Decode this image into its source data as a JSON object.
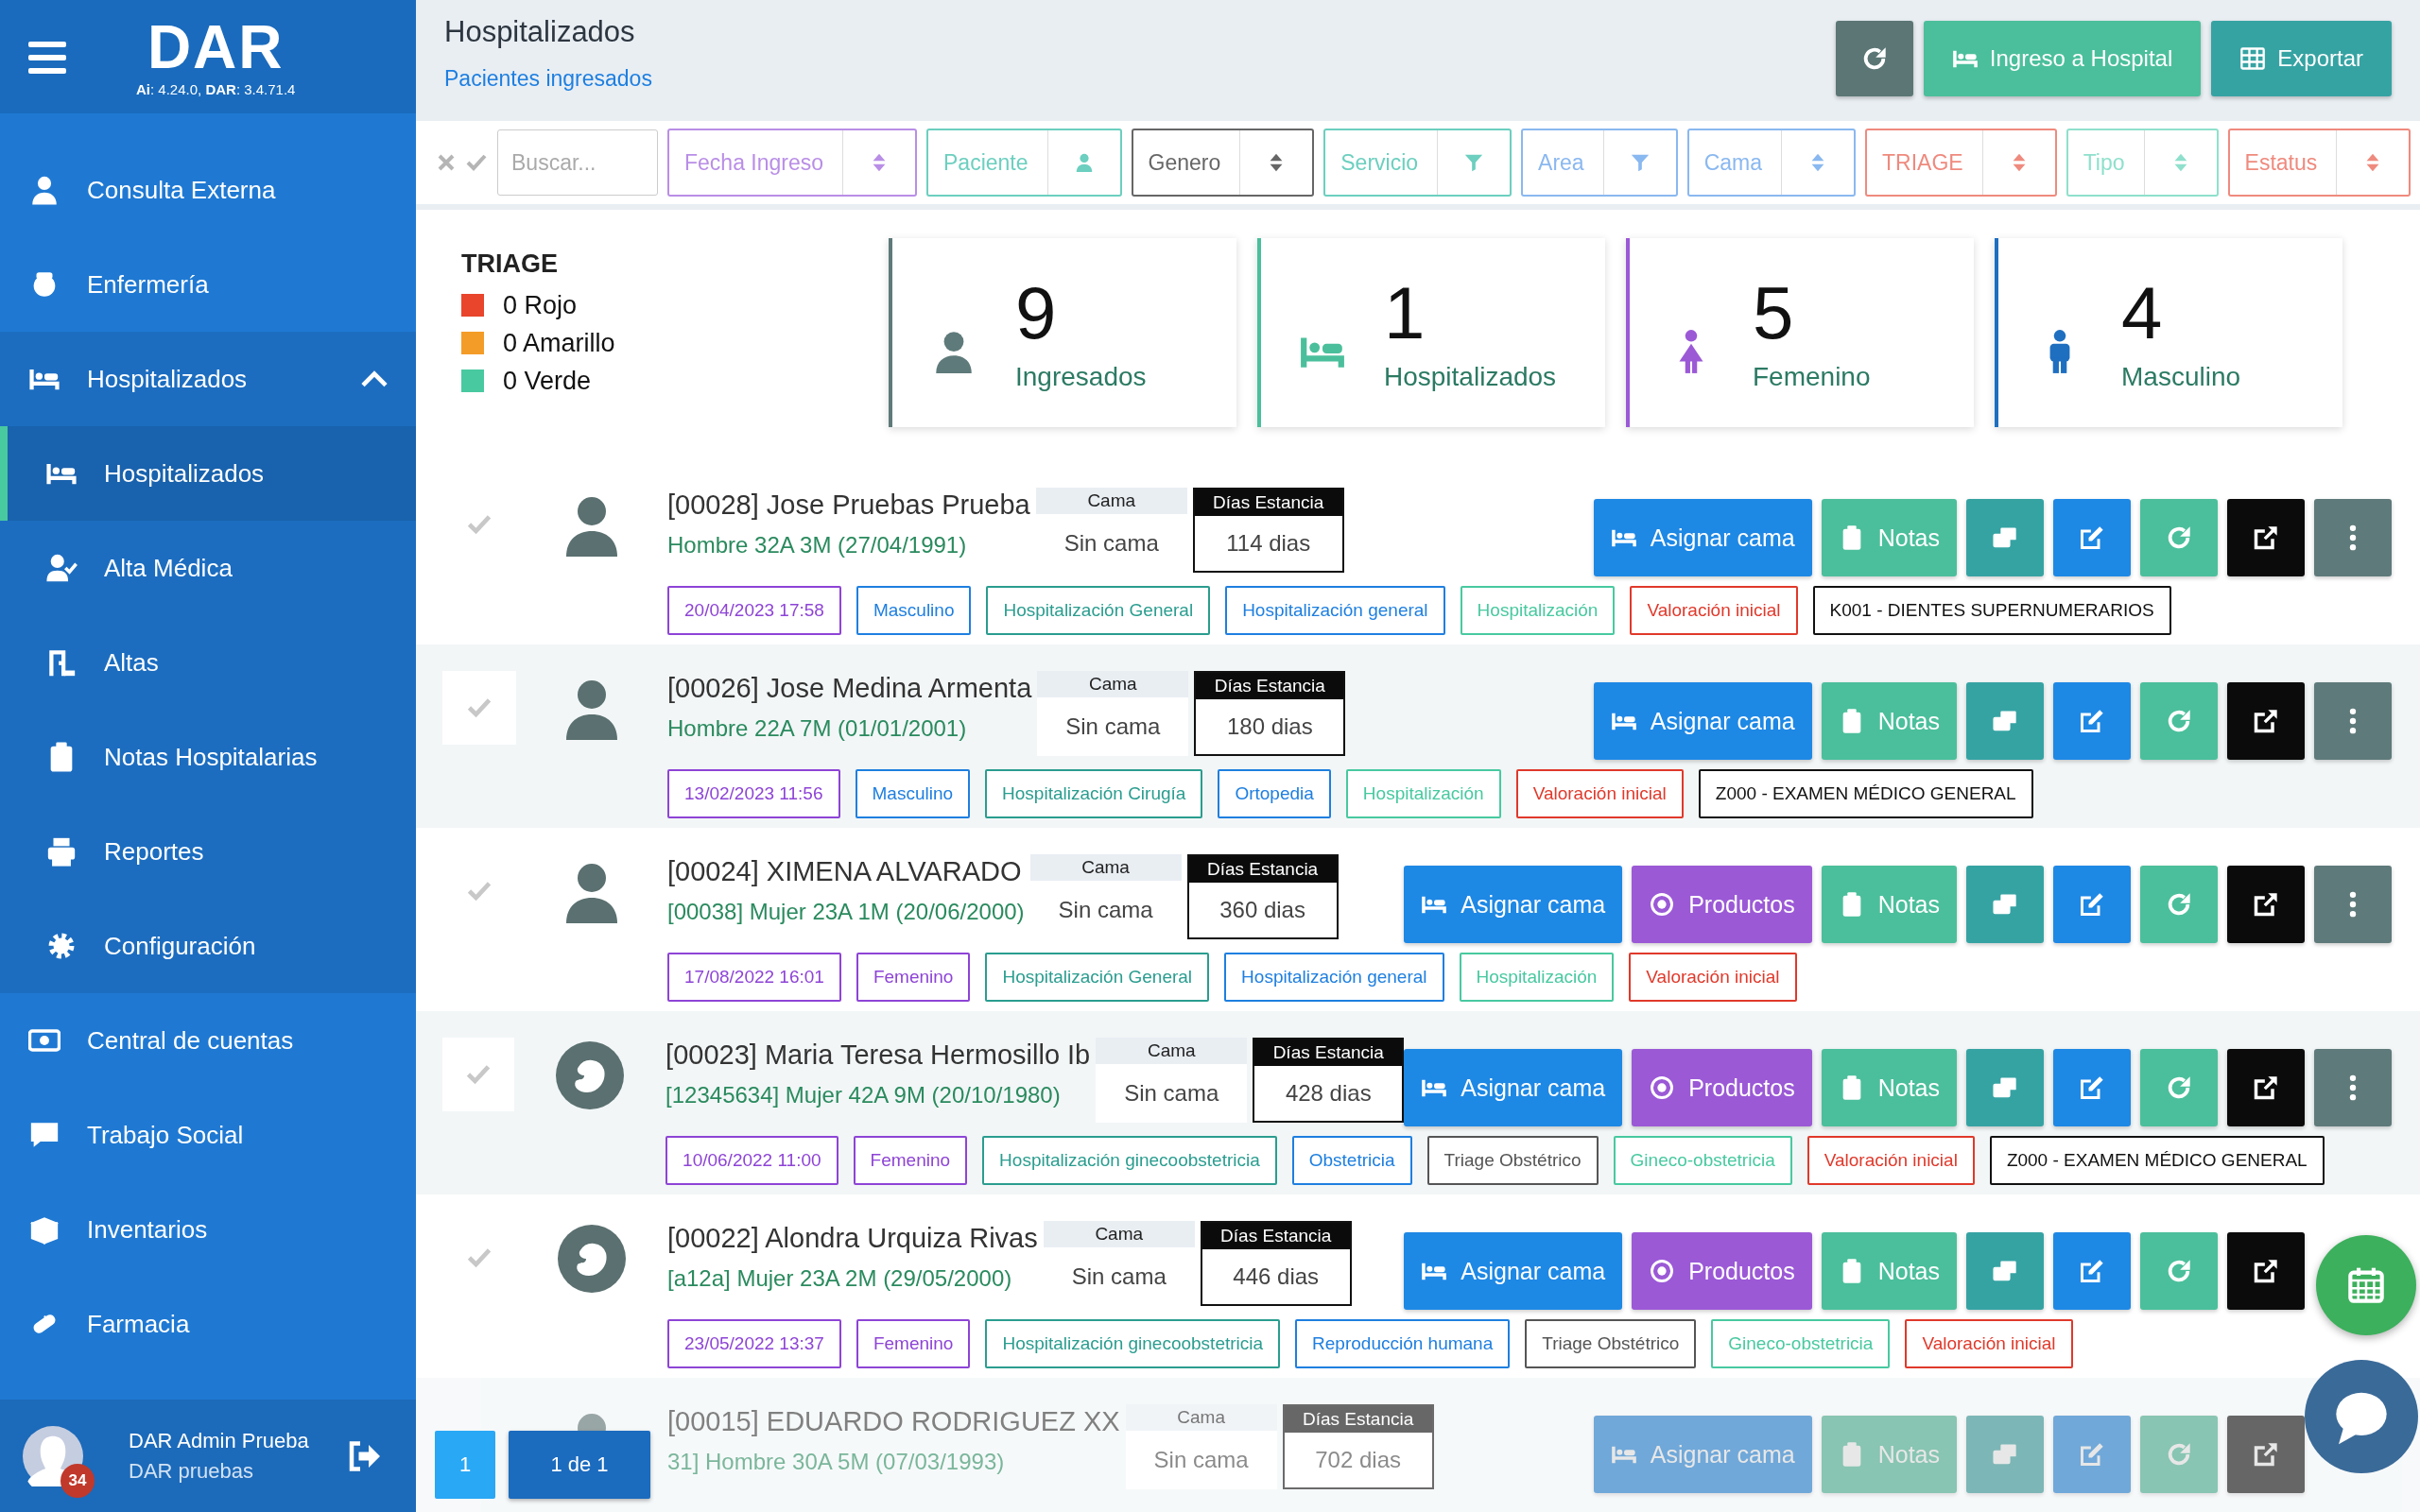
{
  "sidebar": {
    "logo": "DAR",
    "version": "**Ai**: 4.24.0, **DAR**: 3.4.71.4",
    "items": [
      {
        "label": "Consulta Externa"
      },
      {
        "label": "Enfermería"
      },
      {
        "label": "Hospitalizados",
        "expanded": true,
        "children": [
          {
            "label": "Hospitalizados",
            "selected": true
          },
          {
            "label": "Alta Médica",
            "selected": false
          },
          {
            "label": "Altas",
            "selected": false
          },
          {
            "label": "Notas Hospitalarias",
            "selected": false
          },
          {
            "label": "Reportes",
            "selected": false
          },
          {
            "label": "Configuración",
            "selected": false
          }
        ]
      },
      {
        "label": "Central de cuentas"
      },
      {
        "label": "Trabajo Social"
      },
      {
        "label": "Inventarios"
      },
      {
        "label": "Farmacia"
      }
    ],
    "user": {
      "name": "DAR Admin Prueba",
      "org": "DAR pruebas",
      "badge": "34"
    }
  },
  "header": {
    "title": "Hospitalizados",
    "subtitle": "Pacientes ingresados",
    "buttons": [
      {
        "kind": "refresh"
      },
      {
        "kind": "ingreso",
        "label": "Ingreso a Hospital"
      },
      {
        "kind": "export",
        "label": "Exportar"
      }
    ]
  },
  "filters": {
    "search": {
      "placeholder": "Buscar..."
    },
    "fields": [
      {
        "label": "Fecha Ingreso",
        "kind": "sort",
        "color": "#b98ee6"
      },
      {
        "label": "Paciente",
        "kind": "person",
        "color": "#6ccfbf"
      },
      {
        "label": "Genero",
        "kind": "sort",
        "color": "#666666"
      },
      {
        "label": "Servicio",
        "kind": "filter",
        "color": "#6ccfbf"
      },
      {
        "label": "Area",
        "kind": "filter",
        "color": "#8ab8f0"
      },
      {
        "label": "Cama",
        "kind": "sort",
        "color": "#8ab8f0"
      },
      {
        "label": "TRIAGE",
        "kind": "sort",
        "color": "#ef8a7e"
      },
      {
        "label": "Tipo",
        "kind": "sort",
        "color": "#8fe0cc"
      },
      {
        "label": "Estatus",
        "kind": "sort",
        "color": "#ef8a7e"
      }
    ]
  },
  "triage": {
    "title": "TRIAGE",
    "items": [
      {
        "label": "0 Rojo",
        "color": "#e8452c"
      },
      {
        "label": "0 Amarillo",
        "color": "#f39c28"
      },
      {
        "label": "0 Verde",
        "color": "#48c9a0"
      }
    ]
  },
  "stats": [
    {
      "value": "9",
      "label": "Ingresados",
      "color": "#5f7a7a"
    },
    {
      "value": "1",
      "label": "Hospitalizados",
      "color": "#4bbf9b"
    },
    {
      "value": "5",
      "label": "Femenino",
      "color": "#9b59d6"
    },
    {
      "value": "4",
      "label": "Masculino",
      "color": "#1e6fc0"
    }
  ],
  "patients": [
    {
      "kind": "general",
      "checked": false,
      "disabled": false,
      "name": "[00028] Jose Pruebas Prueba",
      "detail": "Hombre 32A 3M (27/04/1991)",
      "cama_label": "Cama",
      "cama": "Sin cama",
      "dias_label": "Días Estancia",
      "dias": "114 dias",
      "actions": [
        {
          "kind": "asignar",
          "label": "Asignar cama"
        },
        {
          "kind": "notas",
          "label": "Notas"
        },
        {
          "kind": "copy"
        },
        {
          "kind": "edit"
        },
        {
          "kind": "refresh"
        },
        {
          "kind": "open"
        },
        {
          "kind": "more"
        }
      ],
      "tags": [
        {
          "text": "20/04/2023 17:58",
          "color": "#8e44d6"
        },
        {
          "text": "Masculino",
          "color": "#1e7fe0"
        },
        {
          "text": "Hospitalización General",
          "color": "#2a9d8f"
        },
        {
          "text": "Hospitalización general",
          "color": "#1e7fe0"
        },
        {
          "text": "Hospitalización",
          "color": "#48c9a0"
        },
        {
          "text": "Valoración inicial",
          "color": "#e0392b"
        },
        {
          "text": "K001 - DIENTES SUPERNUMERARIOS",
          "color": "#111111"
        }
      ]
    },
    {
      "kind": "general",
      "checked": false,
      "disabled": false,
      "name": "[00026] Jose Medina Armenta",
      "detail": "Hombre 22A 7M (01/01/2001)",
      "cama_label": "Cama",
      "cama": "Sin cama",
      "dias_label": "Días Estancia",
      "dias": "180 dias",
      "actions": [
        {
          "kind": "asignar",
          "label": "Asignar cama"
        },
        {
          "kind": "notas",
          "label": "Notas"
        },
        {
          "kind": "copy"
        },
        {
          "kind": "edit"
        },
        {
          "kind": "refresh"
        },
        {
          "kind": "open"
        },
        {
          "kind": "more"
        }
      ],
      "tags": [
        {
          "text": "13/02/2023 11:56",
          "color": "#8e44d6"
        },
        {
          "text": "Masculino",
          "color": "#1e7fe0"
        },
        {
          "text": "Hospitalización Cirugía",
          "color": "#2a9d8f"
        },
        {
          "text": "Ortopedia",
          "color": "#1e7fe0"
        },
        {
          "text": "Hospitalización",
          "color": "#48c9a0"
        },
        {
          "text": "Valoración inicial",
          "color": "#e0392b"
        },
        {
          "text": "Z000 - EXAMEN MÉDICO GENERAL",
          "color": "#111111"
        }
      ]
    },
    {
      "kind": "general",
      "checked": false,
      "disabled": false,
      "name": "[00024] XIMENA ALVARADO",
      "detail": "[00038] Mujer 23A 1M (20/06/2000)",
      "cama_label": "Cama",
      "cama": "Sin cama",
      "dias_label": "Días Estancia",
      "dias": "360 dias",
      "actions": [
        {
          "kind": "asignar",
          "label": "Asignar cama"
        },
        {
          "kind": "productos",
          "label": "Productos"
        },
        {
          "kind": "notas",
          "label": "Notas"
        },
        {
          "kind": "copy"
        },
        {
          "kind": "edit"
        },
        {
          "kind": "refresh"
        },
        {
          "kind": "open"
        },
        {
          "kind": "more"
        }
      ],
      "tags": [
        {
          "text": "17/08/2022 16:01",
          "color": "#8e44d6"
        },
        {
          "text": "Femenino",
          "color": "#8e44d6"
        },
        {
          "text": "Hospitalización General",
          "color": "#2a9d8f"
        },
        {
          "text": "Hospitalización general",
          "color": "#1e7fe0"
        },
        {
          "text": "Hospitalización",
          "color": "#48c9a0"
        },
        {
          "text": "Valoración inicial",
          "color": "#e0392b"
        }
      ]
    },
    {
      "kind": "obstetric",
      "checked": false,
      "disabled": false,
      "name": "[00023] Maria Teresa Hermosillo Ib",
      "detail": "[12345634] Mujer 42A 9M (20/10/1980)",
      "cama_label": "Cama",
      "cama": "Sin cama",
      "dias_label": "Días Estancia",
      "dias": "428 dias",
      "actions": [
        {
          "kind": "asignar",
          "label": "Asignar cama"
        },
        {
          "kind": "productos",
          "label": "Productos"
        },
        {
          "kind": "notas",
          "label": "Notas"
        },
        {
          "kind": "copy"
        },
        {
          "kind": "edit"
        },
        {
          "kind": "refresh"
        },
        {
          "kind": "open"
        },
        {
          "kind": "more"
        }
      ],
      "tags": [
        {
          "text": "10/06/2022 11:00",
          "color": "#8e44d6"
        },
        {
          "text": "Femenino",
          "color": "#8e44d6"
        },
        {
          "text": "Hospitalización ginecoobstetricia",
          "color": "#2a9d8f"
        },
        {
          "text": "Obstetricia",
          "color": "#1e7fe0"
        },
        {
          "text": "Triage Obstétrico",
          "color": "#555555"
        },
        {
          "text": "Gineco-obstetricia",
          "color": "#48c9a0"
        },
        {
          "text": "Valoración inicial",
          "color": "#e0392b"
        },
        {
          "text": "Z000 - EXAMEN MÉDICO GENERAL",
          "color": "#111111"
        }
      ]
    },
    {
      "kind": "obstetric",
      "checked": false,
      "disabled": false,
      "name": "[00022] Alondra Urquiza Rivas",
      "detail": "[a12a] Mujer 23A 2M (29/05/2000)",
      "cama_label": "Cama",
      "cama": "Sin cama",
      "dias_label": "Días Estancia",
      "dias": "446 dias",
      "actions": [
        {
          "kind": "asignar",
          "label": "Asignar cama"
        },
        {
          "kind": "productos",
          "label": "Productos"
        },
        {
          "kind": "notas",
          "label": "Notas"
        },
        {
          "kind": "copy"
        },
        {
          "kind": "edit"
        },
        {
          "kind": "refresh"
        },
        {
          "kind": "open"
        }
      ],
      "tags": [
        {
          "text": "23/05/2022 13:37",
          "color": "#8e44d6"
        },
        {
          "text": "Femenino",
          "color": "#8e44d6"
        },
        {
          "text": "Hospitalización ginecoobstetricia",
          "color": "#2a9d8f"
        },
        {
          "text": "Reproducción humana",
          "color": "#1e7fe0"
        },
        {
          "text": "Triage Obstétrico",
          "color": "#555555"
        },
        {
          "text": "Gineco-obstetricia",
          "color": "#48c9a0"
        },
        {
          "text": "Valoración inicial",
          "color": "#e0392b"
        }
      ]
    },
    {
      "kind": "general",
      "disabled": true,
      "name": "[00015] EDUARDO RODRIGUEZ XX",
      "detail": "31] Hombre 30A 5M (07/03/1993)",
      "cama_label": "Cama",
      "cama": "Sin cama",
      "dias_label": "Días Estancia",
      "dias": "702 dias",
      "actions": [
        {
          "kind": "asignar",
          "label": "Asignar cama"
        },
        {
          "kind": "notas",
          "label": "Notas"
        },
        {
          "kind": "copy"
        },
        {
          "kind": "edit"
        },
        {
          "kind": "refresh"
        },
        {
          "kind": "open"
        }
      ]
    }
  ],
  "pagination": {
    "pages": [
      {
        "label": "1",
        "selected": true
      }
    ],
    "summary": "1 de 1"
  }
}
